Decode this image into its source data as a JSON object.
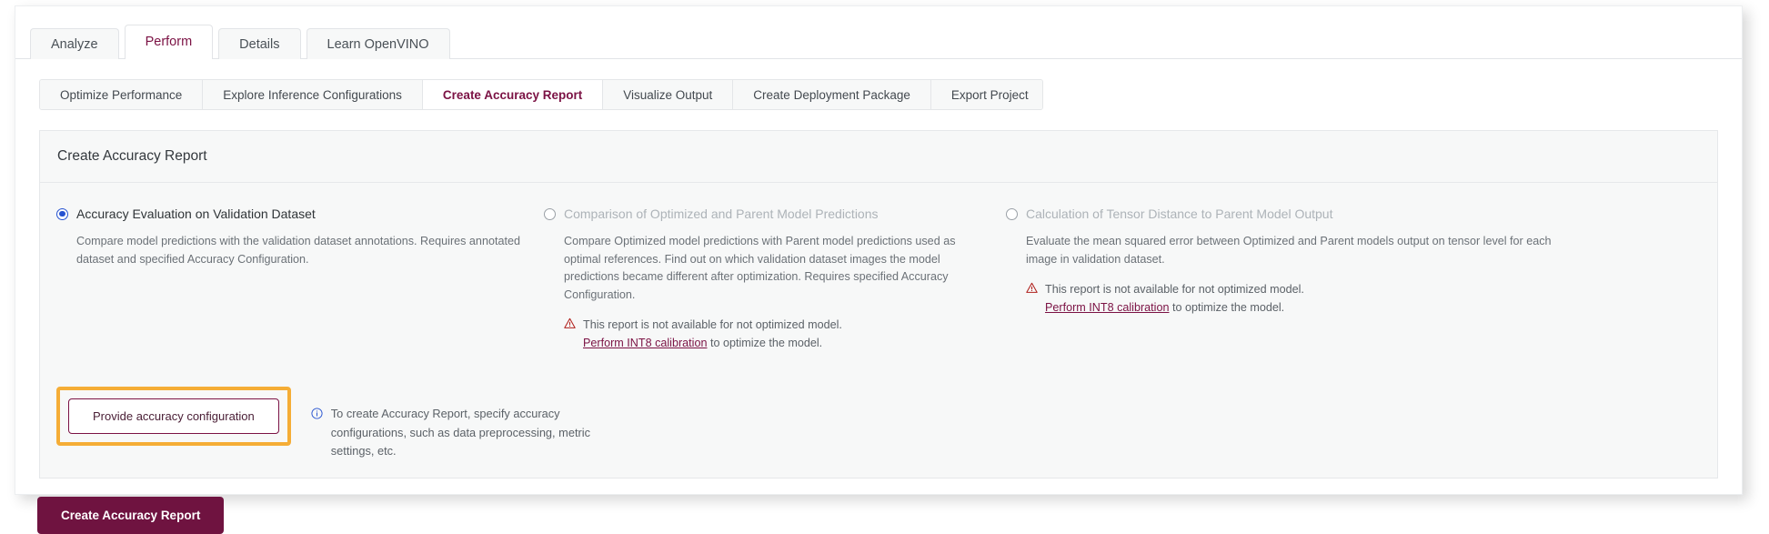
{
  "primary_tabs": [
    {
      "label": "Analyze",
      "active": false
    },
    {
      "label": "Perform",
      "active": true
    },
    {
      "label": "Details",
      "active": false
    },
    {
      "label": "Learn OpenVINO",
      "active": false
    }
  ],
  "secondary_tabs": [
    {
      "label": "Optimize Performance",
      "active": false
    },
    {
      "label": "Explore Inference Configurations",
      "active": false
    },
    {
      "label": "Create Accuracy Report",
      "active": true
    },
    {
      "label": "Visualize Output",
      "active": false
    },
    {
      "label": "Create Deployment Package",
      "active": false
    },
    {
      "label": "Export Project",
      "active": false
    }
  ],
  "panel": {
    "title": "Create Accuracy Report"
  },
  "options": [
    {
      "label": "Accuracy Evaluation on Validation Dataset",
      "selected": true,
      "disabled": false,
      "description": "Compare model predictions with the validation dataset annotations. Requires annotated dataset and specified Accuracy Configuration.",
      "note": null
    },
    {
      "label": "Comparison of Optimized and Parent Model Predictions",
      "selected": false,
      "disabled": true,
      "description": "Compare Optimized model predictions with Parent model predictions used as optimal references. Find out on which validation dataset images the model predictions became different after optimization. Requires specified Accuracy Configuration.",
      "note": {
        "icon": "warning-icon",
        "prefix": "This report is not available for not optimized model. ",
        "link": "Perform INT8 calibration",
        "suffix": " to optimize the model."
      }
    },
    {
      "label": "Calculation of Tensor Distance to Parent Model Output",
      "selected": false,
      "disabled": true,
      "description": "Evaluate the mean squared error between Optimized and Parent models output on tensor level for each image in validation dataset.",
      "note": {
        "icon": "warning-icon",
        "prefix": "This report is not available for not optimized model. ",
        "link": "Perform INT8 calibration",
        "suffix": " to optimize the model."
      }
    }
  ],
  "actions": {
    "provide_config_label": "Provide accuracy configuration",
    "info_icon": "info-icon",
    "info_text": "To create Accuracy Report, specify accuracy configurations, such as data preprocessing, metric settings, etc.",
    "create_report_label": "Create Accuracy Report"
  },
  "colors": {
    "brand": "#7b1244",
    "primary_button": "#6f1340",
    "highlight": "#f5ad36",
    "radio_selected": "#2552d0",
    "warning": "#b0201c",
    "info": "#2552d0"
  }
}
